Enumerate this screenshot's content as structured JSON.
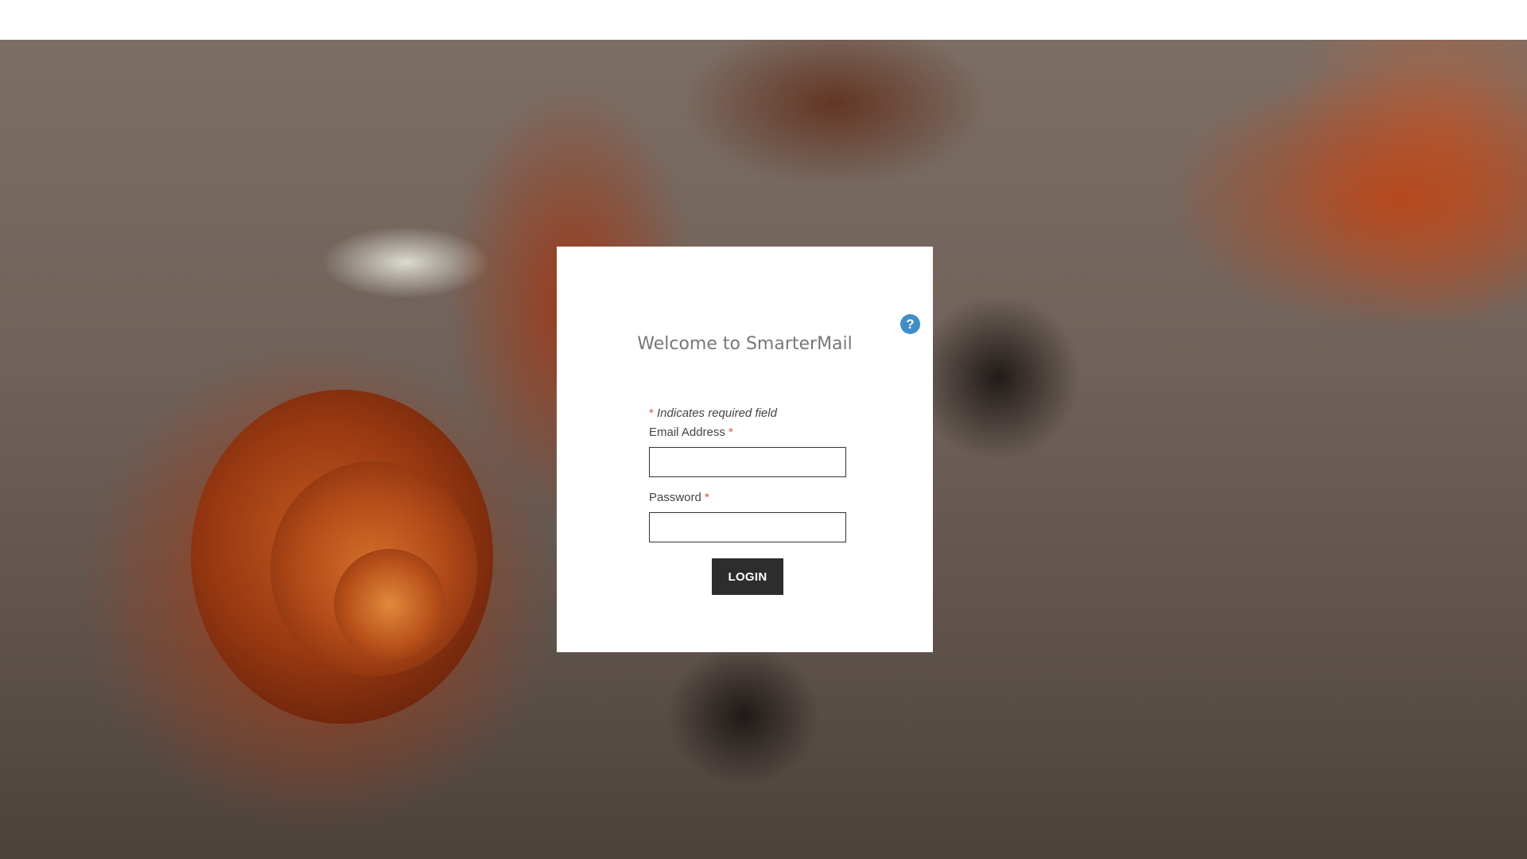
{
  "login": {
    "title": "Welcome to SmarterMail",
    "required_asterisk": "*",
    "required_note": "Indicates required field",
    "email_label": "Email Address",
    "email_value": "",
    "password_label": "Password",
    "password_value": "",
    "login_button": "LOGIN",
    "help_icon": "?"
  },
  "colors": {
    "accent": "#3f8fc7",
    "required": "#d9534f",
    "button": "#2d2d2d"
  },
  "icons": {
    "help": "help-icon"
  }
}
